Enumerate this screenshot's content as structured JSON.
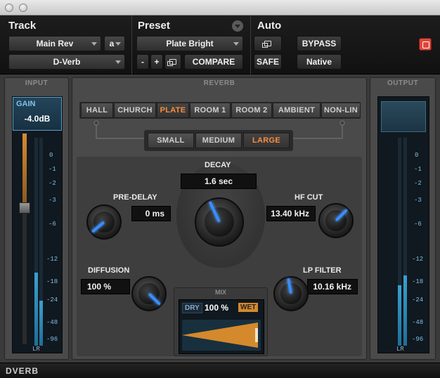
{
  "header": {
    "track_label": "Track",
    "preset_label": "Preset",
    "auto_label": "Auto",
    "track_name": "Main Rev",
    "track_channel": "a",
    "plugin_name": "D-Verb",
    "preset_name": "Plate Bright",
    "minus_label": "-",
    "plus_label": "+",
    "compare_label": "COMPARE",
    "safe_label": "SAFE",
    "bypass_label": "BYPASS",
    "native_label": "Native"
  },
  "input": {
    "title": "INPUT",
    "gain_label": "GAIN",
    "gain_value": "-4.0dB",
    "lr_label": "LR",
    "ticks": [
      "0",
      "-1",
      "-2",
      "-3",
      "-6",
      "-12",
      "-18",
      "-24",
      "-48",
      "-96"
    ]
  },
  "output": {
    "title": "OUTPUT",
    "lr_label": "LR",
    "ticks": [
      "0",
      "-1",
      "-2",
      "-3",
      "-6",
      "-12",
      "-18",
      "-24",
      "-48",
      "-96"
    ]
  },
  "reverb": {
    "title": "REVERB",
    "algorithms": [
      "HALL",
      "CHURCH",
      "PLATE",
      "ROOM 1",
      "ROOM 2",
      "AMBIENT",
      "NON-LIN"
    ],
    "selected_algorithm": "PLATE",
    "sizes": [
      "SMALL",
      "MEDIUM",
      "LARGE"
    ],
    "selected_size": "LARGE",
    "decay_label": "DECAY",
    "decay_value": "1.6 sec",
    "predelay_label": "PRE-DELAY",
    "predelay_value": "0 ms",
    "hfcut_label": "HF CUT",
    "hfcut_value": "13.40 kHz",
    "diffusion_label": "DIFFUSION",
    "diffusion_value": "100 %",
    "lpfilter_label": "LP FILTER",
    "lpfilter_value": "10.16 kHz"
  },
  "mix": {
    "title": "MIX",
    "dry_label": "DRY",
    "value": "100 %",
    "wet_label": "WET",
    "level": 1.0
  },
  "footer": {
    "label": "DVERB"
  },
  "colors": {
    "accent": "#ff8c3a",
    "knob_indicator": "#3a8cff",
    "meter": "#3aa0d0",
    "mix_fill": "#d4892c"
  }
}
